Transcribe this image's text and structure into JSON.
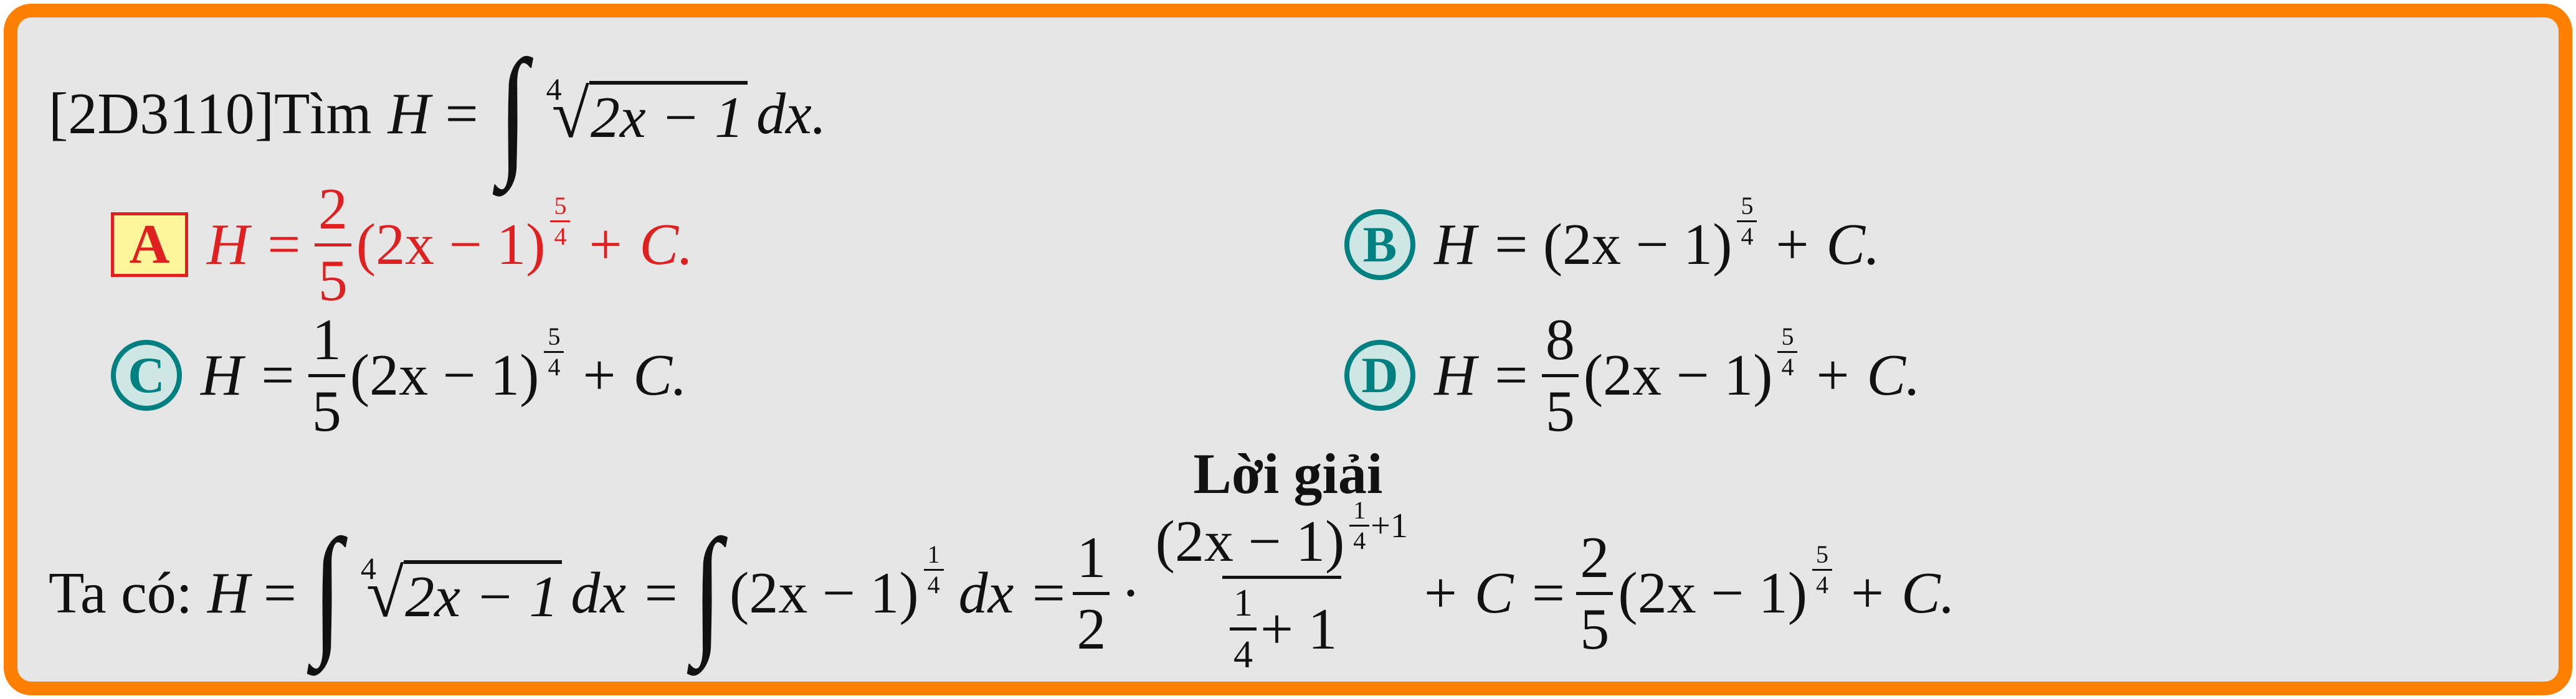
{
  "question": {
    "code": "[2D3110]",
    "lead": "Tìm",
    "H": "H",
    "equals": "=",
    "root_index": "4",
    "radicand": "2x − 1",
    "dx": "dx."
  },
  "options": [
    {
      "label": "A",
      "correct": true,
      "lhs": "H =",
      "coef_num": "2",
      "coef_den": "5",
      "base": "(2x − 1)",
      "exp_num": "5",
      "exp_den": "4",
      "tail": "+ C."
    },
    {
      "label": "B",
      "correct": false,
      "lhs": "H =",
      "base": "(2x − 1)",
      "exp_num": "5",
      "exp_den": "4",
      "tail": "+ C."
    },
    {
      "label": "C",
      "correct": false,
      "lhs": "H =",
      "coef_num": "1",
      "coef_den": "5",
      "base": "(2x − 1)",
      "exp_num": "5",
      "exp_den": "4",
      "tail": "+ C."
    },
    {
      "label": "D",
      "correct": false,
      "lhs": "H =",
      "coef_num": "8",
      "coef_den": "5",
      "base": "(2x − 1)",
      "exp_num": "5",
      "exp_den": "4",
      "tail": "+ C."
    }
  ],
  "solution": {
    "heading": "Lời giải",
    "intro": "Ta có:",
    "H": "H",
    "eq1": "=",
    "root_index": "4",
    "radicand": "2x − 1",
    "dx1": "dx =",
    "base": "(2x − 1)",
    "exp1_num": "1",
    "exp1_den": "4",
    "dx2": "dx =",
    "half_num": "1",
    "half_den": "2",
    "dot": "·",
    "big_num_base": "(2x − 1)",
    "big_num_exp_num": "1",
    "big_num_exp_den": "4",
    "big_num_exp_tail": "+1",
    "big_den_num": "1",
    "big_den_den": "4",
    "big_den_tail": "+ 1",
    "mid": "+ C =",
    "final_num": "2",
    "final_den": "5",
    "final_base": "(2x − 1)",
    "final_exp_num": "5",
    "final_exp_den": "4",
    "final_tail": "+ C."
  },
  "colors": {
    "frame": "#ff8000",
    "background": "#e6e6e6",
    "correct": "#e02020",
    "badge_fill": "#fff59a",
    "option_circle": "#008080"
  }
}
